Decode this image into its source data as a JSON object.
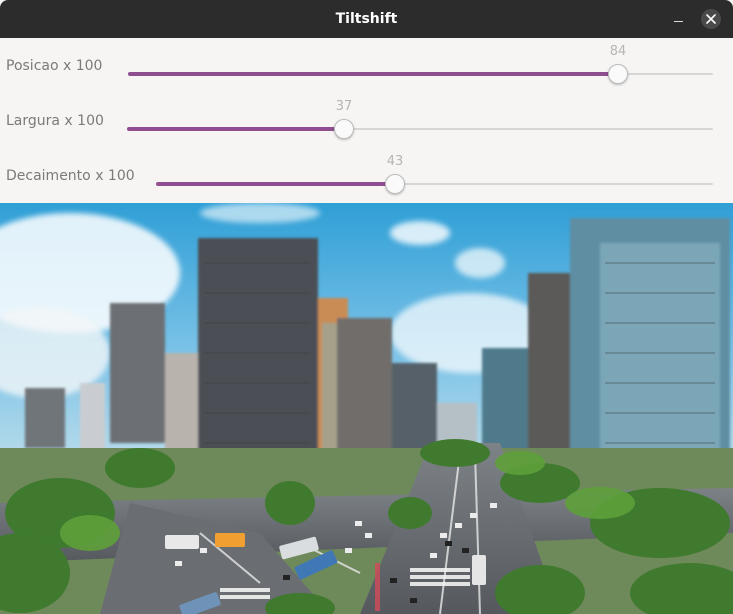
{
  "window": {
    "title": "Tiltshift"
  },
  "sliders": [
    {
      "label": "Posicao x 100",
      "value": 84
    },
    {
      "label": "Largura x 100",
      "value": 37
    },
    {
      "label": "Decaimento x 100",
      "value": 43
    }
  ],
  "icons": {
    "minimize": "minimize-icon",
    "close": "close-icon"
  },
  "colors": {
    "accent": "#8e4e8f",
    "titlebar": "#2c2c2c"
  }
}
